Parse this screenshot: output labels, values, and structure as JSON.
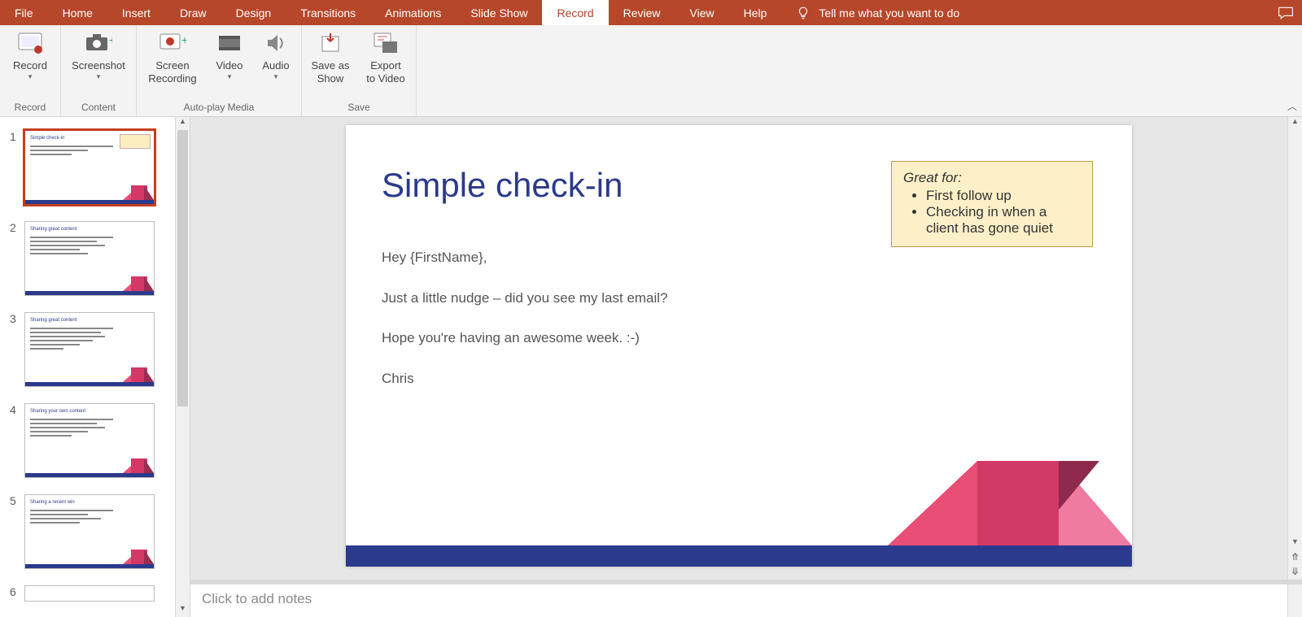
{
  "tabs": {
    "file": "File",
    "home": "Home",
    "insert": "Insert",
    "draw": "Draw",
    "design": "Design",
    "transitions": "Transitions",
    "animations": "Animations",
    "slideshow": "Slide Show",
    "record": "Record",
    "review": "Review",
    "view": "View",
    "help": "Help",
    "tellme": "Tell me what you want to do"
  },
  "ribbon": {
    "groups": {
      "record": "Record",
      "content": "Content",
      "autoplay": "Auto-play Media",
      "save": "Save"
    },
    "buttons": {
      "record": "Record",
      "screenshot": "Screenshot",
      "screenrec_l1": "Screen",
      "screenrec_l2": "Recording",
      "video": "Video",
      "audio": "Audio",
      "saveas_l1": "Save as",
      "saveas_l2": "Show",
      "export_l1": "Export",
      "export_l2": "to Video"
    }
  },
  "thumbs": [
    {
      "num": "1",
      "title": "Simple check-in",
      "note": true
    },
    {
      "num": "2",
      "title": "Sharing great content",
      "note": false
    },
    {
      "num": "3",
      "title": "Sharing great content",
      "note": false
    },
    {
      "num": "4",
      "title": "Sharing your own content",
      "note": false
    },
    {
      "num": "5",
      "title": "Sharing a recent win",
      "note": false
    },
    {
      "num": "6",
      "title": "",
      "note": false
    }
  ],
  "slide": {
    "title": "Simple check-in",
    "body": {
      "p1": "Hey {FirstName},",
      "p2": "Just a little nudge – did you see my last email?",
      "p3": "Hope you're having an awesome week. :-)",
      "p4": "Chris"
    },
    "callout": {
      "header": "Great for:",
      "b1": "First follow up",
      "b2": "Checking in when a client has gone quiet"
    }
  },
  "notes_placeholder": "Click to add notes"
}
